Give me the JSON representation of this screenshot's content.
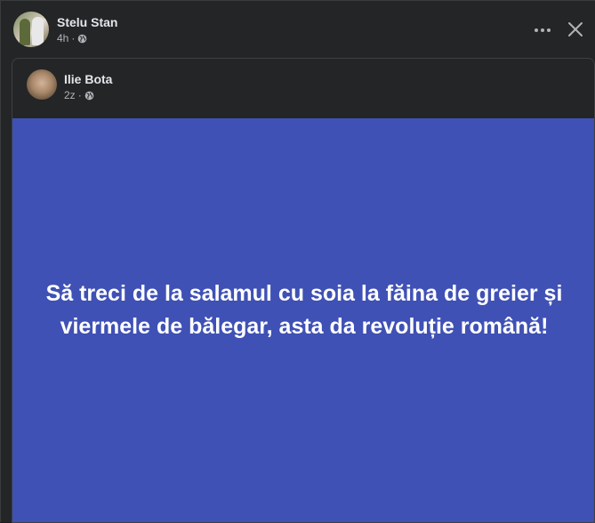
{
  "post": {
    "author_name": "Stelu Stan",
    "time": "4h",
    "separator": "·",
    "privacy_icon": "globe-icon",
    "more_icon": "more-horizontal-icon",
    "close_icon": "close-icon"
  },
  "shared_post": {
    "author_name": "Ilie Bota",
    "time": "2z",
    "separator": "·",
    "privacy_icon": "globe-icon",
    "text": "Să treci de la salamul cu soia la făina de greier și viermele de bălegar, asta da revoluție română!",
    "background_color": "#3f51b5"
  },
  "colors": {
    "surface": "#242526",
    "primary_text": "#e4e6eb",
    "secondary_text": "#b0b3b8"
  }
}
